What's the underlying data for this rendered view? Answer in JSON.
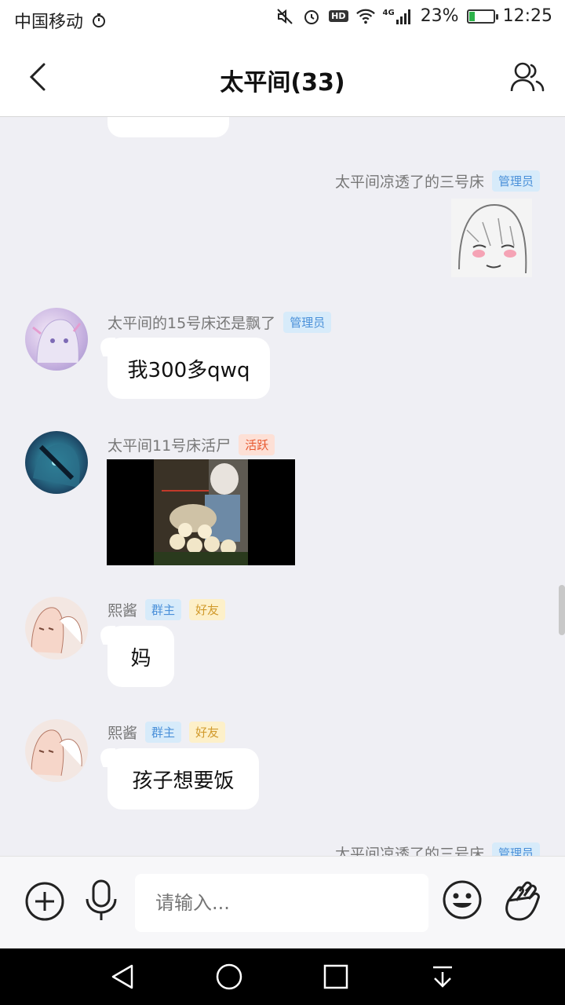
{
  "status_bar": {
    "carrier": "中国移动",
    "signal_tag": "4G",
    "hd": "HD",
    "battery": "23%",
    "time": "12:25"
  },
  "header": {
    "title": "太平间(33)"
  },
  "messages": [
    {
      "sender": "太平间凉透了的三号床",
      "badges": [
        "管理员"
      ]
    },
    {
      "sender": "太平间的15号床还是飘了",
      "badges": [
        "管理员"
      ],
      "text": "我300多qwq"
    },
    {
      "sender": "太平间11号床活尸",
      "badges": [
        "活跃"
      ]
    },
    {
      "sender": "熙酱",
      "badges": [
        "群主",
        "好友"
      ],
      "text": "妈"
    },
    {
      "sender": "熙酱",
      "badges": [
        "群主",
        "好友"
      ],
      "text": "孩子想要饭"
    },
    {
      "sender": "太平间凉透了的三号床",
      "badges": [
        "管理员"
      ]
    }
  ],
  "input_bar": {
    "placeholder": "请输入..."
  },
  "colors": {
    "admin_badge": "#4a90d9",
    "friend_badge": "#d19a2c",
    "active_badge": "#e8582f",
    "battery_fill": "#2db34a"
  }
}
